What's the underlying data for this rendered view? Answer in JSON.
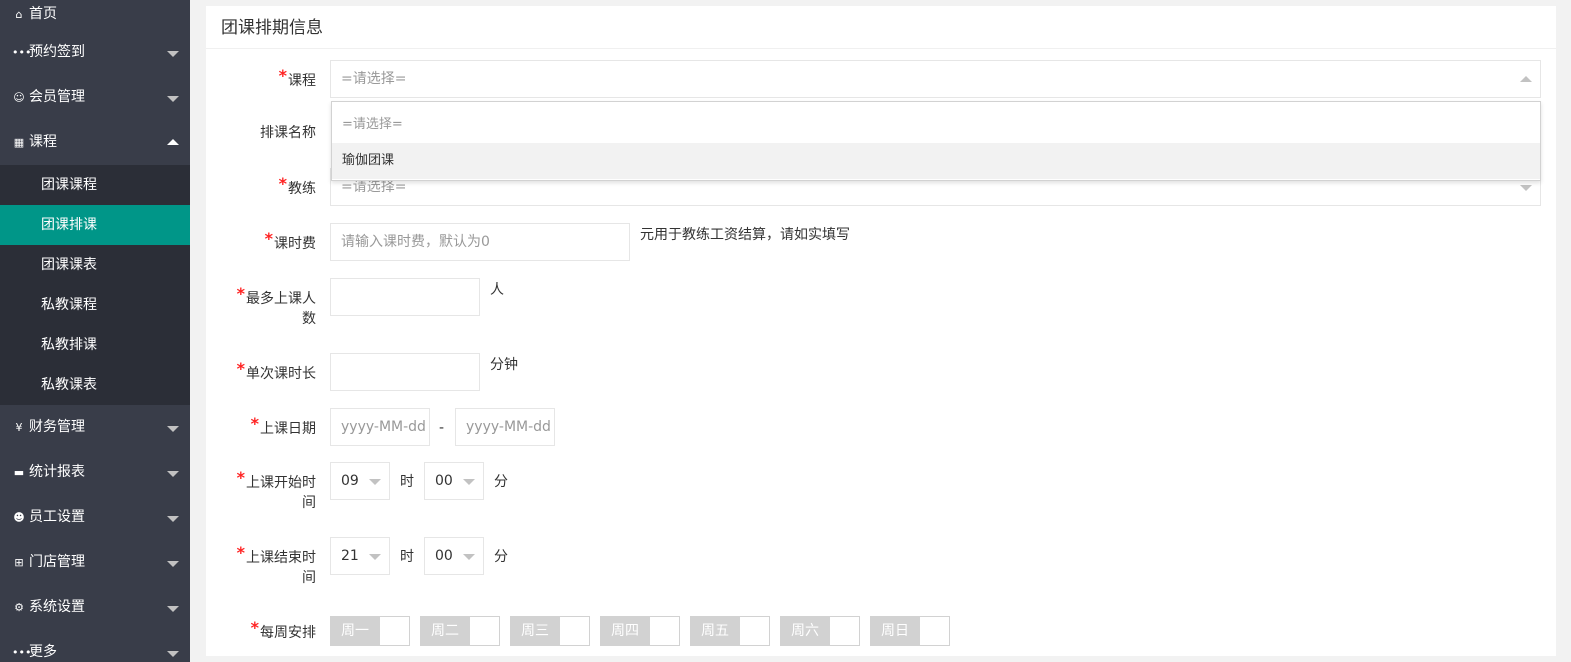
{
  "sidebar": {
    "items": [
      {
        "label": "首页",
        "icon": "home-icon"
      },
      {
        "label": "预约签到",
        "icon": "more-dots-icon"
      },
      {
        "label": "会员管理",
        "icon": "user-icon"
      },
      {
        "label": "课程",
        "icon": "grid-icon"
      },
      {
        "label": "财务管理",
        "icon": "yen-icon"
      },
      {
        "label": "统计报表",
        "icon": "chart-icon"
      },
      {
        "label": "员工设置",
        "icon": "users-icon"
      },
      {
        "label": "门店管理",
        "icon": "store-icon"
      },
      {
        "label": "系统设置",
        "icon": "gear-icon"
      },
      {
        "label": "更多",
        "icon": "more-dots-icon"
      }
    ],
    "course_sub": [
      "团课课程",
      "团课排课",
      "团课课表",
      "私教课程",
      "私教排课",
      "私教课表"
    ],
    "active_sub": "团课排课"
  },
  "panel": {
    "title": "团课排期信息"
  },
  "form": {
    "course": {
      "label": "课程",
      "placeholder": "=请选择="
    },
    "course_options": [
      "=请选择=",
      "瑜伽团课"
    ],
    "schedule_name": {
      "label": "排课名称"
    },
    "coach": {
      "label": "教练",
      "placeholder": "=请选择="
    },
    "fee": {
      "label": "课时费",
      "placeholder": "请输入课时费，默认为0",
      "unit": "元用于教练工资结算，请如实填写"
    },
    "max_people": {
      "label_line1": "最多上课人",
      "label_line2": "数",
      "unit": "人"
    },
    "duration": {
      "label": "单次课时长",
      "unit": "分钟"
    },
    "date": {
      "label": "上课日期",
      "start_placeholder": "yyyy-MM-dd",
      "end_placeholder": "yyyy-MM-dd",
      "separator": "-"
    },
    "start_time": {
      "label_line1": "上课开始时",
      "label_line2": "间",
      "hour": "09",
      "minute": "00",
      "hour_unit": "时",
      "minute_unit": "分"
    },
    "end_time": {
      "label_line1": "上课结束时",
      "label_line2": "间",
      "hour": "21",
      "minute": "00",
      "hour_unit": "时",
      "minute_unit": "分"
    },
    "weekly": {
      "label": "每周安排",
      "days": [
        "周一",
        "周二",
        "周三",
        "周四",
        "周五",
        "周六",
        "周日"
      ]
    }
  },
  "colors": {
    "sidebar_bg": "#393d49",
    "subnav_bg": "#2b2e37",
    "active": "#009688",
    "required": "#ff2222"
  }
}
